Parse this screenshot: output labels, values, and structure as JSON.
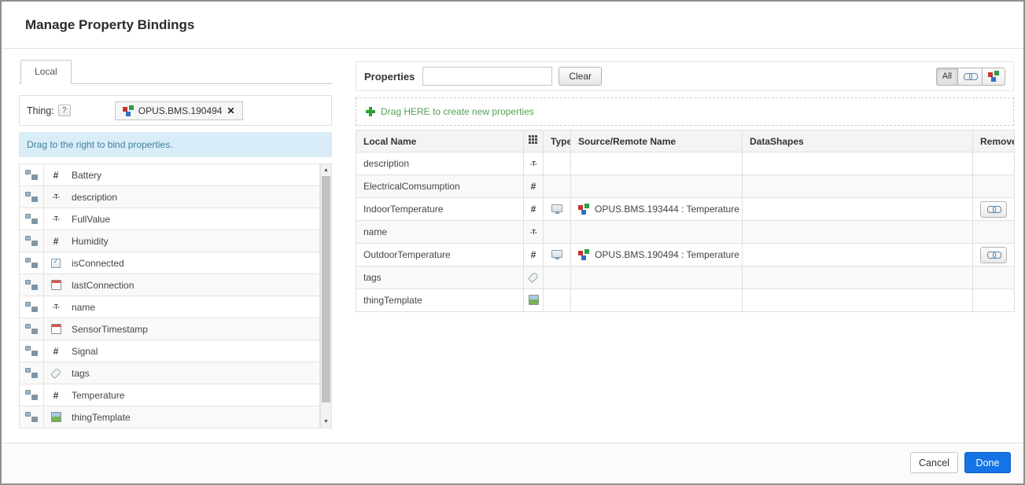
{
  "dialog": {
    "title": "Manage Property Bindings"
  },
  "left": {
    "tab_label": "Local",
    "thing_label": "Thing:",
    "help_label": "?",
    "thing_name": "OPUS.BMS.190494",
    "info_text": "Drag to the right to bind properties.",
    "properties": [
      {
        "name": "Battery",
        "type": "number"
      },
      {
        "name": "description",
        "type": "string"
      },
      {
        "name": "FullValue",
        "type": "string"
      },
      {
        "name": "Humidity",
        "type": "number"
      },
      {
        "name": "isConnected",
        "type": "boolean"
      },
      {
        "name": "lastConnection",
        "type": "datetime"
      },
      {
        "name": "name",
        "type": "string"
      },
      {
        "name": "SensorTimestamp",
        "type": "datetime"
      },
      {
        "name": "Signal",
        "type": "number"
      },
      {
        "name": "tags",
        "type": "tags"
      },
      {
        "name": "Temperature",
        "type": "number"
      },
      {
        "name": "thingTemplate",
        "type": "template"
      }
    ]
  },
  "right": {
    "properties_label": "Properties",
    "search_value": "",
    "clear_label": "Clear",
    "filter_all_label": "All",
    "drop_hint": "Drag HERE to create new properties",
    "table": {
      "headers": {
        "local_name": "Local Name",
        "type": "Type",
        "source": "Source/Remote Name",
        "datashapes": "DataShapes",
        "remove": "Remove"
      },
      "rows": [
        {
          "local_name": "description",
          "type": "string",
          "bound": "false",
          "source": ""
        },
        {
          "local_name": "ElectricalComsumption",
          "type": "number",
          "bound": "false",
          "source": ""
        },
        {
          "local_name": "IndoorTemperature",
          "type": "number",
          "bound": "true",
          "source": "OPUS.BMS.193444 :  Temperature"
        },
        {
          "local_name": "name",
          "type": "string",
          "bound": "false",
          "source": ""
        },
        {
          "local_name": "OutdoorTemperature",
          "type": "number",
          "bound": "true",
          "source": "OPUS.BMS.190494 :  Temperature"
        },
        {
          "local_name": "tags",
          "type": "tags",
          "bound": "false",
          "source": ""
        },
        {
          "local_name": "thingTemplate",
          "type": "template",
          "bound": "false",
          "source": ""
        }
      ]
    }
  },
  "footer": {
    "cancel_label": "Cancel",
    "done_label": "Done"
  }
}
